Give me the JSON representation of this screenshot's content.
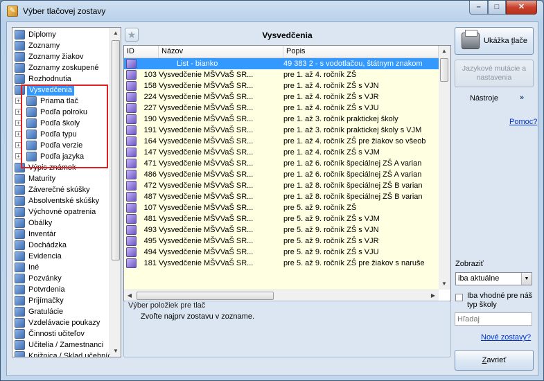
{
  "window": {
    "title": "Výber tlačovej zostavy",
    "controls": {
      "min": "–",
      "max": "□",
      "close": "✕"
    }
  },
  "tree": {
    "items": [
      {
        "label": "Diplomy",
        "top": 0,
        "indent": 0
      },
      {
        "label": "Zoznamy",
        "indent": 0
      },
      {
        "label": "Zoznamy žiakov",
        "indent": 0
      },
      {
        "label": "Zoznamy zoskupené",
        "indent": 0
      },
      {
        "label": "Rozhodnutia",
        "indent": 0
      },
      {
        "label": "Vysvedčenia",
        "indent": 0,
        "selected": true
      },
      {
        "label": "Priama tlač",
        "indent": 1
      },
      {
        "label": "Podľa polroku",
        "indent": 1
      },
      {
        "label": "Podľa školy",
        "indent": 1
      },
      {
        "label": "Podľa typu",
        "indent": 1
      },
      {
        "label": "Podľa verzie",
        "indent": 1
      },
      {
        "label": "Podľa jazyka",
        "indent": 1
      },
      {
        "label": "Výpis známok",
        "indent": 0
      },
      {
        "label": "Maturity",
        "indent": 0
      },
      {
        "label": "Záverečné skúšky",
        "indent": 0
      },
      {
        "label": "Absolventské skúšky",
        "indent": 0
      },
      {
        "label": "Výchovné opatrenia",
        "indent": 0
      },
      {
        "label": "Obálky",
        "indent": 0
      },
      {
        "label": "Inventár",
        "indent": 0
      },
      {
        "label": "Dochádzka",
        "indent": 0
      },
      {
        "label": "Evidencia",
        "indent": 0
      },
      {
        "label": "Iné",
        "indent": 0
      },
      {
        "label": "Pozvánky",
        "indent": 0
      },
      {
        "label": "Potvrdenia",
        "indent": 0
      },
      {
        "label": "Prijímačky",
        "indent": 0
      },
      {
        "label": "Gratulácie",
        "indent": 0
      },
      {
        "label": "Vzdelávacie poukazy",
        "indent": 0
      },
      {
        "label": "Činnosti učiteľov",
        "indent": 0
      },
      {
        "label": "Učitelia / Zamestnanci",
        "indent": 0
      },
      {
        "label": "Knižnica / Sklad učebníc",
        "indent": 0
      }
    ]
  },
  "center": {
    "title": "Vysvedčenia",
    "columns": [
      "ID",
      "Názov",
      "Popis"
    ],
    "rows": [
      {
        "id": "",
        "name": "List - bianko",
        "desc": "49 383 2 - s vodotlačou, štátnym znakom",
        "selected": true
      },
      {
        "id": "103",
        "name": "Vysvedčenie MŠVVaŠ SR...",
        "desc": "pre 1. až 4. ročník ZŠ"
      },
      {
        "id": "158",
        "name": "Vysvedčenie MŠVVaŠ SR...",
        "desc": "pre 1. až 4. ročník ZŠ s VJN"
      },
      {
        "id": "224",
        "name": "Vysvedčenie MŠVVaŠ SR...",
        "desc": "pre 1. až 4. ročník ZŠ s VJR"
      },
      {
        "id": "227",
        "name": "Vysvedčenie MŠVVaŠ SR...",
        "desc": "pre 1. až 4. ročník ZŠ s VJU"
      },
      {
        "id": "190",
        "name": "Vysvedčenie MŠVVaŠ SR...",
        "desc": "pre 1. až 3. ročník praktickej školy"
      },
      {
        "id": "191",
        "name": "Vysvedčenie MŠVVaŠ SR...",
        "desc": "pre 1. až 3. ročník praktickej školy s VJM"
      },
      {
        "id": "164",
        "name": "Vysvedčenie MŠVVaŠ SR...",
        "desc": "pre 1. až 4. ročník ZŠ pre žiakov so všeob"
      },
      {
        "id": "147",
        "name": "Vysvedčenie MŠVVaŠ SR...",
        "desc": "pre 1. až 4. ročník ZŠ s VJM"
      },
      {
        "id": "471",
        "name": "Vysvedčenie MŠVVaŠ SR...",
        "desc": "pre 1. až 6. ročník špeciálnej ZŠ A varian"
      },
      {
        "id": "486",
        "name": "Vysvedčenie MŠVVaŠ SR...",
        "desc": "pre 1. až 6. ročník špeciálnej ZŠ A varian"
      },
      {
        "id": "472",
        "name": "Vysvedčenie MŠVVaŠ SR...",
        "desc": "pre 1. až 8. ročník špeciálnej ZŠ B varian"
      },
      {
        "id": "487",
        "name": "Vysvedčenie MŠVVaŠ SR...",
        "desc": "pre 1. až 8. ročník špeciálnej ZŠ B varian"
      },
      {
        "id": "107",
        "name": "Vysvedčenie MŠVVaŠ SR...",
        "desc": "pre 5. až 9. ročník ZŠ"
      },
      {
        "id": "481",
        "name": "Vysvedčenie MŠVVaŠ SR...",
        "desc": "pre 5. až 9. ročník ZŠ s VJM"
      },
      {
        "id": "493",
        "name": "Vysvedčenie MŠVVaŠ SR...",
        "desc": "pre 5. až 9. ročník ZŠ s VJN"
      },
      {
        "id": "495",
        "name": "Vysvedčenie MŠVVaŠ SR...",
        "desc": "pre 5. až 9. ročník ZŠ s VJR"
      },
      {
        "id": "494",
        "name": "Vysvedčenie MŠVVaŠ SR...",
        "desc": "pre 5. až 9. ročník ZŠ s VJU"
      },
      {
        "id": "181",
        "name": "Vysvedčenie MŠVVaŠ SR...",
        "desc": "pre 5. až 9. ročník ZŠ pre žiakov s naruše"
      }
    ]
  },
  "info": {
    "title": "Výber položiek pre tlač",
    "text": "Zvoľte najprv zostavu v zozname."
  },
  "right": {
    "print_button": {
      "pre": "Ukážka ",
      "u": "t",
      "post": "lače"
    },
    "lang_button": "Jazykové mutácie a nastavenia",
    "tools_label": "Nástroje",
    "tools_chevron": "»",
    "help_link": "Pomoc?",
    "show_label": "Zobraziť",
    "show_value": "iba aktuálne",
    "show_options": [
      "iba aktuálne"
    ],
    "checkbox_label": "Iba vhodné pre náš typ školy",
    "search_placeholder": "Hľadaj",
    "new_reports_link": "Nové zostavy?",
    "close_button": {
      "pre": "",
      "u": "Z",
      "post": "avrieť"
    }
  },
  "colors": {
    "selection": "#3399ff",
    "row_background": "#ffffe1",
    "highlight_box": "#e02020",
    "link": "#0033cc"
  }
}
